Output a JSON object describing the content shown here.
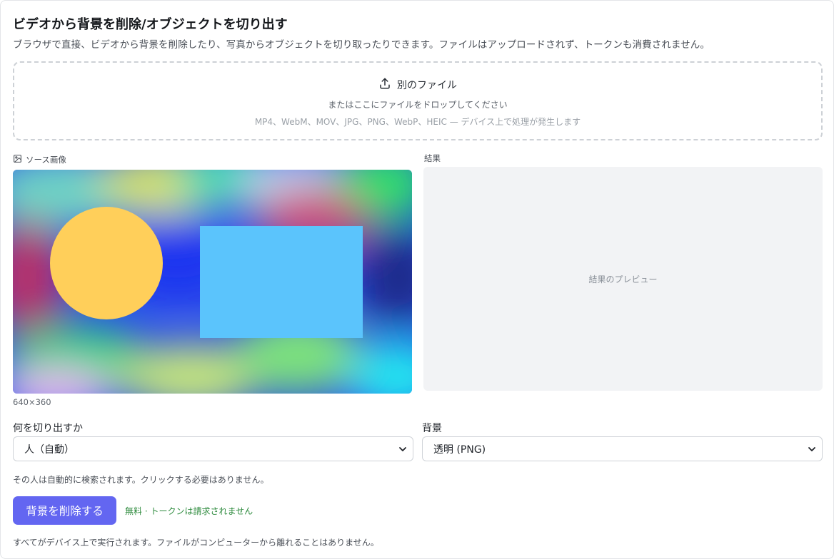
{
  "header": {
    "title": "ビデオから背景を削除/オブジェクトを切り出す",
    "subtitle": "ブラウザで直接、ビデオから背景を削除したり、写真からオブジェクトを切り取ったりできます。ファイルはアップロードされず、トークンも消費されません。"
  },
  "dropzone": {
    "icon": "upload-icon",
    "label": "別のファイル",
    "sub": "またはここにファイルをドロップしてください",
    "hint": "MP4、WebM、MOV、JPG、PNG、WebP、HEIC — デバイス上で処理が発生します"
  },
  "source": {
    "icon": "image-icon",
    "label": "ソース画像",
    "dimensions": "640×360"
  },
  "result": {
    "label": "結果",
    "placeholder": "結果のプレビュー"
  },
  "target_field": {
    "label": "何を切り出すか",
    "value": "人（自動）"
  },
  "background_field": {
    "label": "背景",
    "value": "透明 (PNG)"
  },
  "note": "その人は自動的に検索されます。クリックする必要はありません。",
  "run": {
    "label": "背景を削除する",
    "accent": "#6366f1",
    "free_note": "無料 · トークンは請求されません"
  },
  "footer": "すべてがデバイス上で実行されます。ファイルがコンピューターから離れることはありません。"
}
